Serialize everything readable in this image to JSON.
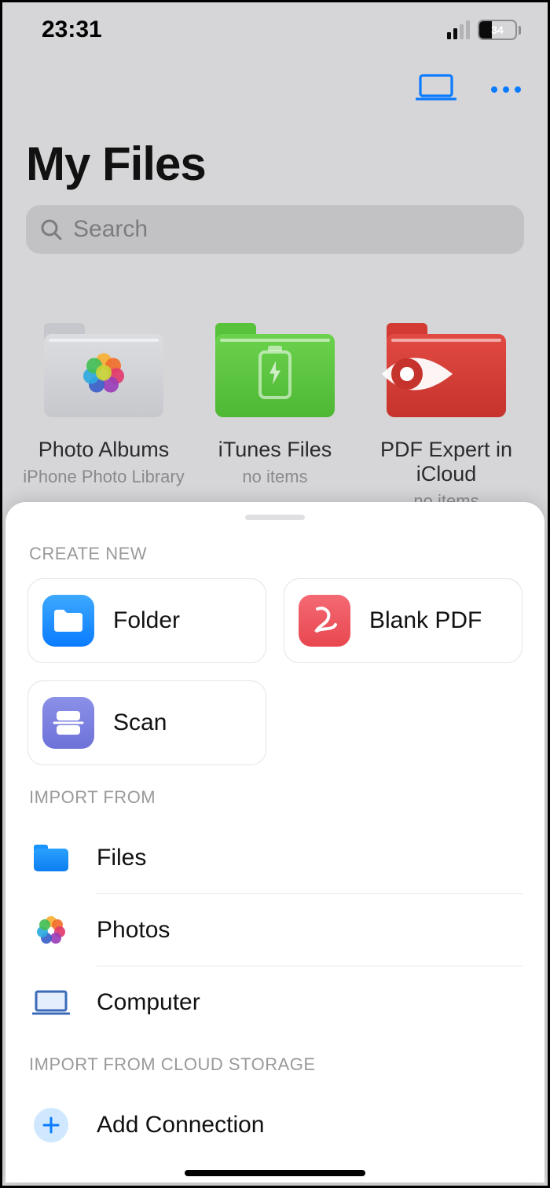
{
  "status": {
    "time": "23:31",
    "battery_pct": "34"
  },
  "header": {
    "title": "My Files"
  },
  "search": {
    "placeholder": "Search"
  },
  "folders": [
    {
      "title": "Photo Albums",
      "subtitle": "iPhone Photo Library"
    },
    {
      "title": "iTunes Files",
      "subtitle": "no items"
    },
    {
      "title": "PDF Expert in iCloud",
      "subtitle": "no items"
    }
  ],
  "sheet": {
    "create_label": "CREATE NEW",
    "tiles": {
      "folder": "Folder",
      "blank_pdf": "Blank PDF",
      "scan": "Scan"
    },
    "import_label": "IMPORT FROM",
    "import": {
      "files": "Files",
      "photos": "Photos",
      "computer": "Computer"
    },
    "cloud_label": "IMPORT FROM CLOUD STORAGE",
    "cloud": {
      "add_connection": "Add Connection"
    }
  }
}
